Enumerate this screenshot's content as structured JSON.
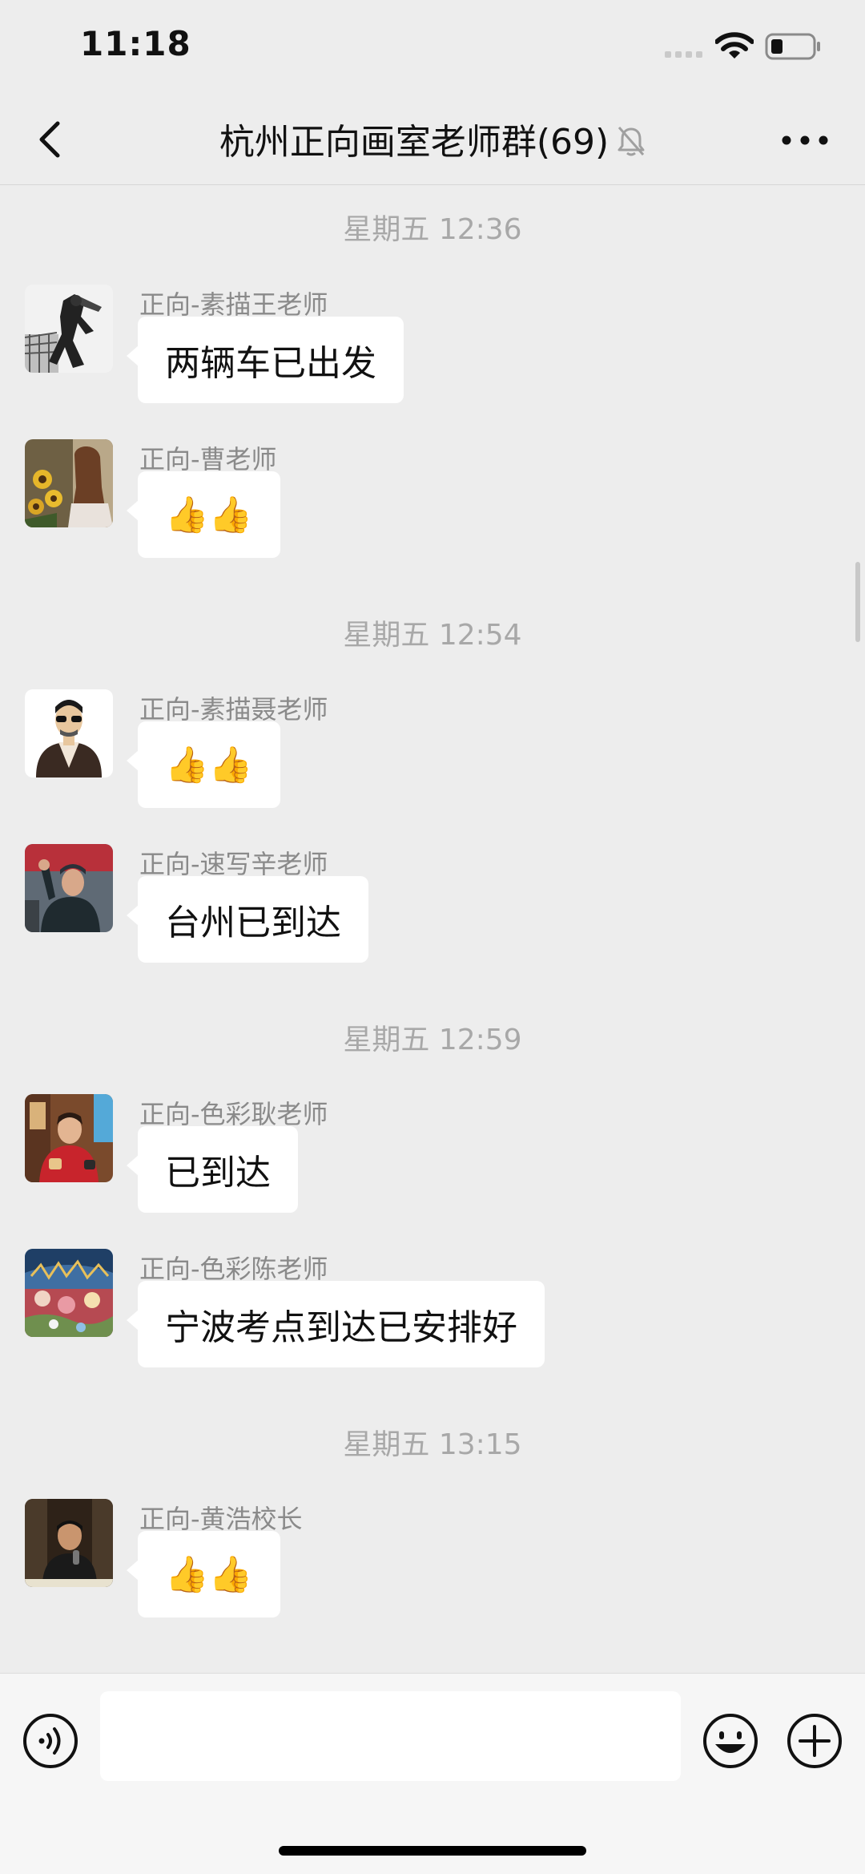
{
  "status_bar": {
    "time": "11:18"
  },
  "nav": {
    "title": "杭州正向画室老师群(69)",
    "icons": {
      "back": "chevron-left-icon",
      "mute": "bell-off-icon",
      "more": "ellipsis-icon"
    }
  },
  "messages": [
    {
      "timestamp": "星期五 12:36"
    },
    {
      "sender": "正向-素描王老师",
      "text": "两辆车已出发",
      "avatar": "sketch-drawing-avatar"
    },
    {
      "sender": "正向-曹老师",
      "text": "👍👍",
      "avatar": "sunflower-girl-avatar"
    },
    {
      "timestamp": "星期五 12:54"
    },
    {
      "sender": "正向-素描聂老师",
      "text": "👍👍",
      "avatar": "cartoon-man-avatar"
    },
    {
      "sender": "正向-速写辛老师",
      "text": "台州已到达",
      "avatar": "waving-man-avatar"
    },
    {
      "timestamp": "星期五 12:59"
    },
    {
      "sender": "正向-色彩耿老师",
      "text": "已到达",
      "avatar": "child-red-sweater-avatar"
    },
    {
      "sender": "正向-色彩陈老师",
      "text": "宁波考点到达已安排好",
      "avatar": "painting-avatar"
    },
    {
      "timestamp": "星期五 13:15"
    },
    {
      "sender": "正向-黄浩校长",
      "text": "👍👍",
      "avatar": "man-speaking-avatar"
    }
  ],
  "colors": {
    "background": "#ededed",
    "bubble": "#ffffff",
    "input_bar": "#f6f6f6",
    "timestamp_text": "#a8a8a8",
    "sender_text": "#8a8a8a"
  },
  "input_bar": {
    "placeholder": "",
    "icons": {
      "voice": "voice-icon",
      "emoji": "emoji-icon",
      "plus": "plus-icon"
    }
  }
}
